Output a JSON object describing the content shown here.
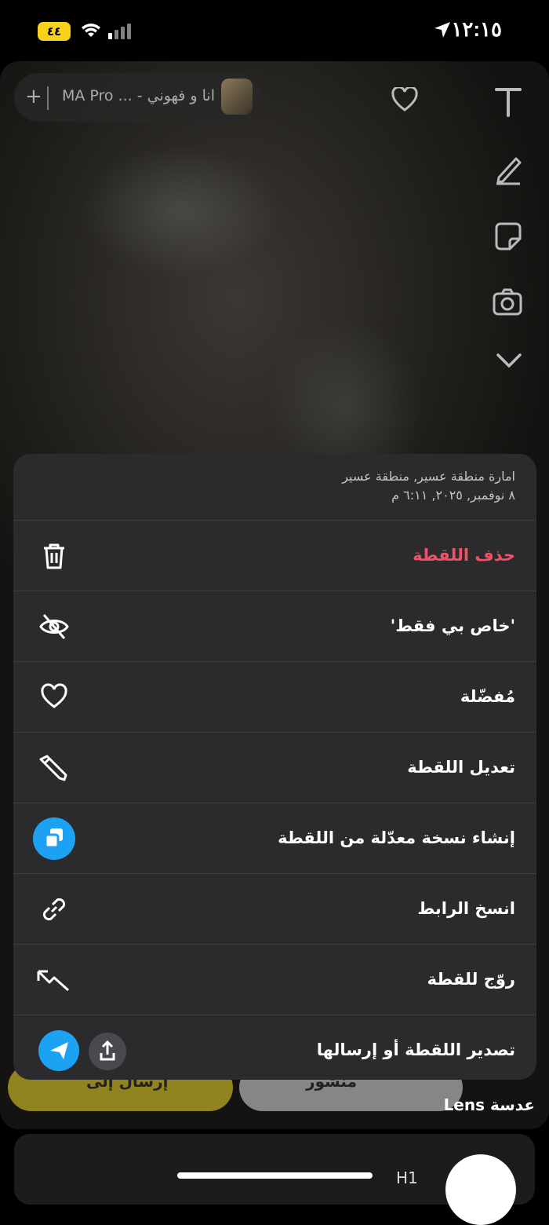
{
  "status_bar": {
    "battery": "٤٤",
    "time": "١٢:١٥"
  },
  "snap": {
    "music_title": "انا و فهوني - ... MA Pro",
    "music_add": "+"
  },
  "sheet": {
    "location": "امارة منطقة عسير, منطقة عسير",
    "date": "٨ نوفمبر, ٢٠٢٥, ٦:١١ م",
    "items": [
      {
        "label": "حذف اللقطة",
        "icon": "trash-icon",
        "danger": true
      },
      {
        "label": "'خاص بي فقط'",
        "icon": "eye-off-icon"
      },
      {
        "label": "مُفضّلة",
        "icon": "heart-icon"
      },
      {
        "label": "تعديل اللقطة",
        "icon": "pencil-icon"
      },
      {
        "label": "إنشاء نسخة معدّلة من اللقطة",
        "icon": "remix-icon"
      },
      {
        "label": "انسخ الرابط",
        "icon": "link-icon"
      },
      {
        "label": "روّج للقطة",
        "icon": "promote-arrow-icon"
      },
      {
        "label": "تصدير اللقطة أو إرسالها",
        "icon": "share-icon"
      }
    ]
  },
  "bottom": {
    "send_to": "إرسال إلى",
    "posted": "منشور",
    "lens": "عدسة Lens",
    "card_text": "H1"
  },
  "colors": {
    "accent_blue": "#1da1f2",
    "danger_red": "#ef5166",
    "battery_yellow": "#f7d21c"
  }
}
